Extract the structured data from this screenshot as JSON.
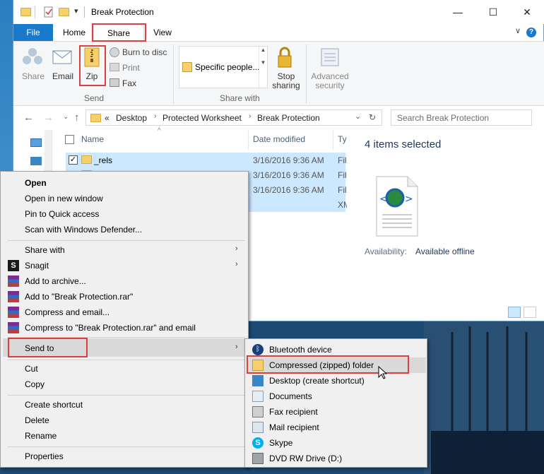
{
  "window": {
    "title": "Break Protection",
    "minimize_glyph": "—",
    "maximize_glyph": "☐",
    "close_glyph": "✕",
    "quick_access_chevron": "▾"
  },
  "tabs": {
    "file": "File",
    "home": "Home",
    "share": "Share",
    "view": "View",
    "help": "?",
    "collapse": "∨"
  },
  "ribbon": {
    "share": "Share",
    "email": "Email",
    "zip": "Zip",
    "burn": "Burn to disc",
    "print": "Print",
    "fax": "Fax",
    "send_group": "Send",
    "share_with_value": "Specific people...",
    "share_with_group": "Share with",
    "stop_sharing_line1": "Stop",
    "stop_sharing_line2": "sharing",
    "advanced_line1": "Advanced",
    "advanced_line2": "security"
  },
  "address": {
    "prefix": "«",
    "crumbs": [
      "Desktop",
      "Protected Worksheet",
      "Break Protection"
    ],
    "separator": "›",
    "search_placeholder": "Search Break Protection",
    "refresh_glyph": "↻",
    "dropdown_glyph": "⌄"
  },
  "nav": {
    "back": "←",
    "forward": "→",
    "dropdown": "⌄",
    "up": "↑"
  },
  "columns": {
    "name": "Name",
    "date_modified": "Date modified",
    "type": "Ty"
  },
  "files": [
    {
      "name": "_rels",
      "date": "3/16/2016 9:36 AM",
      "type": "Fil"
    },
    {
      "name": "",
      "date": "3/16/2016 9:36 AM",
      "type": "Fil"
    },
    {
      "name": "",
      "date": "3/16/2016 9:36 AM",
      "type": "Fil"
    },
    {
      "name": "",
      "date": "",
      "type": "XM"
    }
  ],
  "details": {
    "selected": "4 items selected",
    "availability_label": "Availability:",
    "availability_value": "Available offline"
  },
  "context_menu": {
    "open": "Open",
    "open_new_window": "Open in new window",
    "pin_quick_access": "Pin to Quick access",
    "scan_defender": "Scan with Windows Defender...",
    "share_with": "Share with",
    "snagit": "Snagit",
    "add_archive": "Add to archive...",
    "add_rar": "Add to \"Break Protection.rar\"",
    "compress_email": "Compress and email...",
    "compress_rar_email": "Compress to \"Break Protection.rar\" and email",
    "send_to": "Send to",
    "cut": "Cut",
    "copy": "Copy",
    "create_shortcut": "Create shortcut",
    "delete": "Delete",
    "rename": "Rename",
    "properties": "Properties",
    "arrow": "›"
  },
  "send_to_menu": {
    "bluetooth": "Bluetooth device",
    "compressed": "Compressed (zipped) folder",
    "desktop": "Desktop (create shortcut)",
    "documents": "Documents",
    "fax": "Fax recipient",
    "mail": "Mail recipient",
    "skype": "Skype",
    "dvd": "DVD RW Drive (D:)"
  },
  "colors": {
    "accent": "#1979ca",
    "highlight_box": "#d9403e",
    "selection": "#cce8ff"
  }
}
